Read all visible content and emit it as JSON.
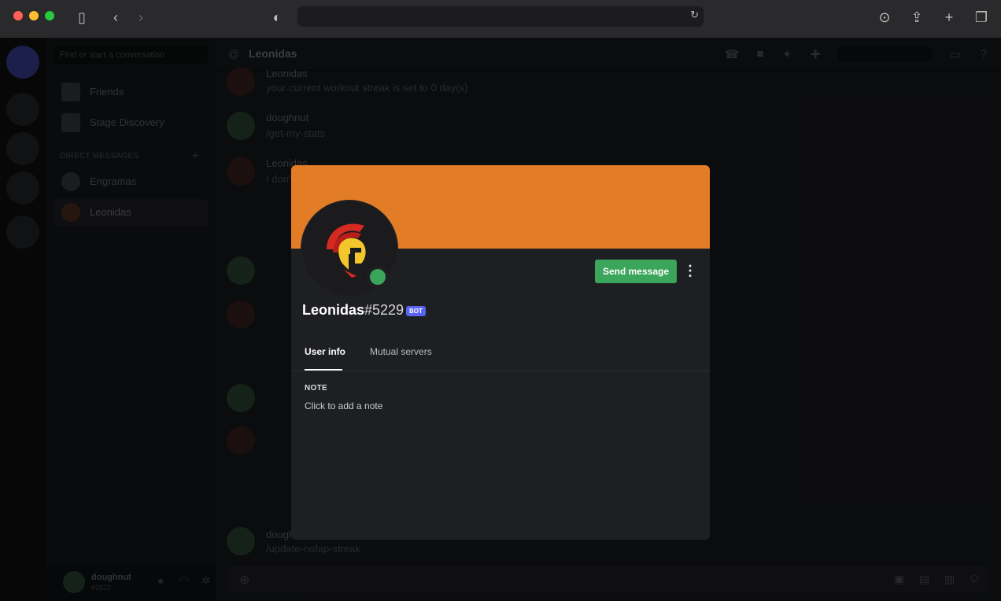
{
  "app": {
    "channel_title": "Leonidas"
  },
  "dm_list": {
    "search_placeholder": "Find or start a conversation",
    "nav": [
      {
        "label": "Friends"
      },
      {
        "label": "Stage Discovery"
      }
    ],
    "heading": "DIRECT MESSAGES",
    "conversations": [
      {
        "label": "Engramas"
      },
      {
        "label": "Leonidas"
      }
    ]
  },
  "user_panel": {
    "name": "doughnut",
    "tag": "#2622"
  },
  "messages": [
    {
      "author": "Leonidas",
      "text": "your current workout streak is set to 0 day(s)"
    },
    {
      "author": "doughnut",
      "text": "/get-my-stats"
    },
    {
      "author": "Leonidas",
      "text": "I don't"
    },
    {
      "author": "doughnut",
      "text": "/update-nofap-streak"
    }
  ],
  "profile": {
    "name": "Leonidas",
    "discriminator": "#5229",
    "badge": "BOT",
    "send_message_label": "Send message",
    "tabs": [
      "User info",
      "Mutual servers"
    ],
    "note_label": "NOTE",
    "note_placeholder": "Click to add a note"
  },
  "colors": {
    "banner": "#e27c27",
    "online": "#3ba55c",
    "button": "#3ba55c",
    "badge": "#5865f2"
  }
}
